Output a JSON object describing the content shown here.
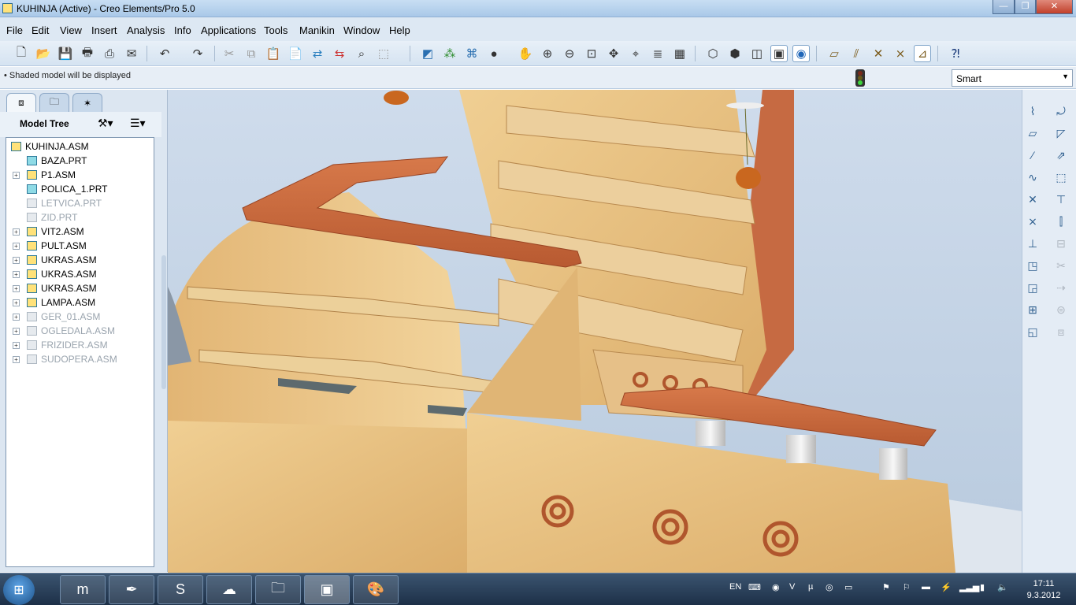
{
  "window": {
    "title": "KUHINJA (Active) - Creo Elements/Pro 5.0",
    "controls": [
      "minimize-icon",
      "maximize-icon",
      "close-icon"
    ]
  },
  "menu": [
    "File",
    "Edit",
    "View",
    "Insert",
    "Analysis",
    "Info",
    "Applications",
    "Tools",
    "Manikin",
    "Window",
    "Help"
  ],
  "toolbar": {
    "icons": [
      "new-icon",
      "open-icon",
      "save-icon",
      "print-icon",
      "print-preview-icon",
      "send-mail-icon",
      "undo-icon",
      "redo-icon",
      "cut-icon",
      "copy-icon",
      "paste-icon",
      "paste-special-icon",
      "regenerate-icon",
      "regen-manager-icon",
      "find-icon",
      "select-box-icon",
      "repaint-icon",
      "spin-center-icon",
      "saved-views-icon",
      "appearance-icon",
      "pan-icon",
      "zoom-in-icon",
      "zoom-out-icon",
      "refit-icon",
      "reorient-icon",
      "saved-orientations-icon",
      "layers-icon",
      "model-display-icon",
      "wireframe-icon",
      "hidden-line-icon",
      "no-hidden-icon",
      "shading-icon",
      "shading-edges-icon",
      "datum-planes-icon",
      "datum-axes-icon",
      "datum-points-icon",
      "coordinate-systems-icon",
      "annotations-icon",
      "whats-this-icon"
    ],
    "active": [
      "shading-icon",
      "shading-edges-icon",
      "annotations-icon"
    ]
  },
  "message": {
    "text": "Shaded model will be displayed",
    "status_icon": "traffic-light-icon"
  },
  "filter": {
    "value": "Smart"
  },
  "navigator": {
    "tabs": [
      "model-tree-tab-icon",
      "folder-browser-tab-icon",
      "favorites-tab-icon"
    ],
    "tree_title": "Model Tree",
    "tree_tools": [
      "settings-icon",
      "show-icon"
    ],
    "items": [
      {
        "label": "KUHINJA.ASM",
        "type": "asm",
        "expand": "",
        "dim": false,
        "root": true
      },
      {
        "label": "BAZA.PRT",
        "type": "prt",
        "expand": "",
        "dim": false
      },
      {
        "label": "P1.ASM",
        "type": "asm",
        "expand": "+",
        "dim": false
      },
      {
        "label": "POLICA_1.PRT",
        "type": "prt",
        "expand": "",
        "dim": false
      },
      {
        "label": "LETVICA.PRT",
        "type": "prt",
        "expand": "",
        "dim": true
      },
      {
        "label": "ZID.PRT",
        "type": "prt",
        "expand": "",
        "dim": true
      },
      {
        "label": "VIT2.ASM",
        "type": "asm",
        "expand": "+",
        "dim": false
      },
      {
        "label": "PULT.ASM",
        "type": "asm",
        "expand": "+",
        "dim": false
      },
      {
        "label": "UKRAS.ASM",
        "type": "asm",
        "expand": "+",
        "dim": false
      },
      {
        "label": "UKRAS.ASM",
        "type": "asm",
        "expand": "+",
        "dim": false
      },
      {
        "label": "UKRAS.ASM",
        "type": "asm",
        "expand": "+",
        "dim": false
      },
      {
        "label": "LAMPA.ASM",
        "type": "asm",
        "expand": "+",
        "dim": false
      },
      {
        "label": "GER_01.ASM",
        "type": "asm",
        "expand": "+",
        "dim": true
      },
      {
        "label": "OGLEDALA.ASM",
        "type": "asm",
        "expand": "+",
        "dim": true
      },
      {
        "label": "FRIZIDER.ASM",
        "type": "asm",
        "expand": "+",
        "dim": true
      },
      {
        "label": "SUDOPERA.ASM",
        "type": "asm",
        "expand": "+",
        "dim": true
      }
    ]
  },
  "right_toolbar": {
    "icons": [
      "sketch-icon",
      "plane-icon",
      "axis-icon",
      "curve-icon",
      "point-icon",
      "csys-icon",
      "analysis-icon",
      "component-icon",
      "repeat-icon",
      "package-icon",
      "hole-icon",
      "round-icon",
      "chamfer-icon",
      "draft-icon",
      "shell-icon",
      "rib-icon",
      "mirror-icon",
      "merge-icon",
      "trim-icon",
      "extend-icon",
      "offset-icon",
      "thicken-icon"
    ]
  },
  "taskbar": {
    "apps": [
      "maxthon-icon",
      "pen-icon",
      "skype-icon",
      "network-icon",
      "explorer-icon",
      "creo-icon",
      "paint-icon"
    ],
    "language": "EN",
    "time": "17:11",
    "date": "9.3.2012"
  },
  "scene": {
    "wood_color": "#e9c486",
    "counter_color": "#c8673a",
    "wall_color": "#c26540",
    "floor_color": "#b86c5a",
    "background_color": "#cbd9ea"
  }
}
